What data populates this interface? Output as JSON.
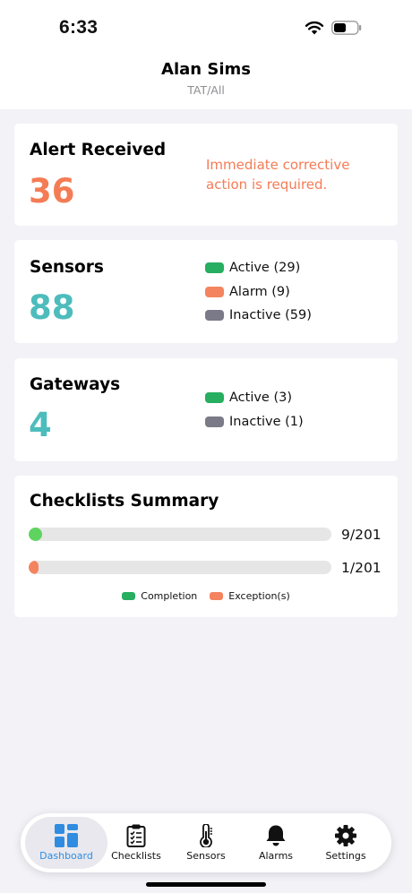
{
  "status_bar": {
    "time": "6:33"
  },
  "header": {
    "title": "Alan Sims",
    "subtitle": "TAT/All"
  },
  "alert_card": {
    "title": "Alert Received",
    "count": "36",
    "message": "Immediate corrective action is required."
  },
  "sensors_card": {
    "title": "Sensors",
    "count": "88",
    "legend": [
      {
        "label": "Active (29)",
        "color": "#27ae60"
      },
      {
        "label": "Alarm (9)",
        "color": "#f4845f"
      },
      {
        "label": "Inactive (59)",
        "color": "#7a7a88"
      }
    ]
  },
  "gateways_card": {
    "title": "Gateways",
    "count": "4",
    "legend": [
      {
        "label": "Active (3)",
        "color": "#27ae60"
      },
      {
        "label": "Inactive (1)",
        "color": "#7a7a88"
      }
    ]
  },
  "checklists_card": {
    "title": "Checklists Summary",
    "bars": [
      {
        "value_text": "9/201",
        "fraction": 0.045,
        "color": "#5fd35f"
      },
      {
        "value_text": "1/201",
        "fraction": 0.03,
        "color": "#f4845f"
      }
    ],
    "legend": [
      {
        "label": "Completion",
        "color": "#27ae60"
      },
      {
        "label": "Exception(s)",
        "color": "#f4845f"
      }
    ]
  },
  "tabbar": {
    "active": "Dashboard",
    "tabs": [
      {
        "label": "Dashboard",
        "icon": "dashboard-grid-icon"
      },
      {
        "label": "Checklists",
        "icon": "clipboard-icon"
      },
      {
        "label": "Sensors",
        "icon": "thermometer-icon"
      },
      {
        "label": "Alarms",
        "icon": "bell-icon"
      },
      {
        "label": "Settings",
        "icon": "gear-icon"
      }
    ]
  },
  "colors": {
    "accent": "#2f8ce0",
    "alert": "#f47c55",
    "teal": "#4dbcbc"
  }
}
